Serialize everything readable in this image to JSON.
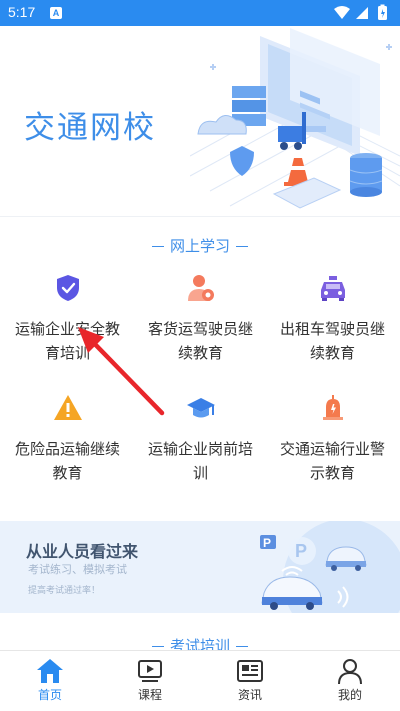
{
  "status_bar": {
    "time": "5:17",
    "notification": "A",
    "icons": [
      "wifi-icon",
      "signal-icon",
      "battery-icon"
    ]
  },
  "banner": {
    "title": "交通网校"
  },
  "section_online": {
    "title": "网上学习"
  },
  "grid": {
    "items": [
      {
        "label": "运输企业安全教育培训",
        "icon": "shield-check-icon",
        "color": "#5b56e3"
      },
      {
        "label": "客货运驾驶员继续教育",
        "icon": "driver-person-icon",
        "color": "#f47a5d"
      },
      {
        "label": "出租车驾驶员继续教育",
        "icon": "taxi-icon",
        "color": "#7b5fe0"
      },
      {
        "label": "危险品运输继续教育",
        "icon": "warning-triangle-icon",
        "color": "#f5a524"
      },
      {
        "label": "运输企业岗前培训",
        "icon": "graduation-cap-icon",
        "color": "#3a7fe6"
      },
      {
        "label": "交通运输行业警示教育",
        "icon": "alarm-bell-icon",
        "color": "#f47a4d"
      }
    ]
  },
  "promo": {
    "title": "从业人员看过来",
    "subtitle": "考试练习、模拟考试",
    "note": "提高考试通过率！"
  },
  "section_exam": {
    "title": "考试培训"
  },
  "bottom_nav": {
    "items": [
      {
        "label": "首页",
        "icon": "home-icon",
        "active": true
      },
      {
        "label": "课程",
        "icon": "play-screen-icon",
        "active": false
      },
      {
        "label": "资讯",
        "icon": "news-icon",
        "active": false
      },
      {
        "label": "我的",
        "icon": "user-icon",
        "active": false
      }
    ]
  },
  "colors": {
    "primary": "#2a8bf0",
    "banner_title": "#3e8ee8",
    "promo_bg": "#eaf2fc",
    "annotation_arrow": "#e8262b"
  }
}
